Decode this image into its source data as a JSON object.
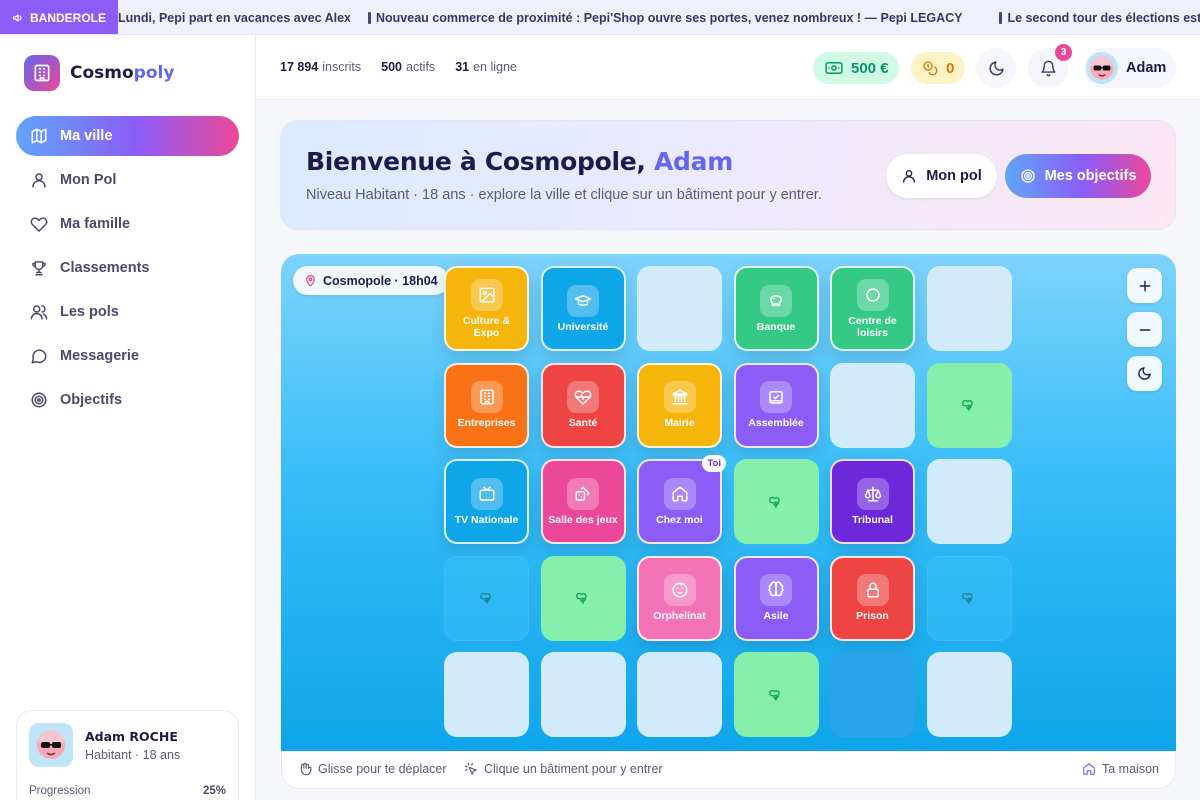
{
  "banner": {
    "tag": "BANDEROLE",
    "items": [
      "Lundi, Pepi part en vacances avec Alexis, Nathan et les Avalon ! — Krishna AVALON",
      "Nouveau commerce de proximité : Pepi'Shop ouvre ses portes, venez nombreux ! — Pepi LEGACY",
      "Le second tour des élections est en cours"
    ]
  },
  "brand": {
    "name_a": "Cosmo",
    "name_b": "poly"
  },
  "nav": [
    {
      "label": "Ma ville",
      "icon": "map-icon",
      "active": true
    },
    {
      "label": "Mon Pol",
      "icon": "user-icon"
    },
    {
      "label": "Ma famille",
      "icon": "heart-icon"
    },
    {
      "label": "Classements",
      "icon": "trophy-icon"
    },
    {
      "label": "Les pols",
      "icon": "users-icon"
    },
    {
      "label": "Messagerie",
      "icon": "message-icon"
    },
    {
      "label": "Objectifs",
      "icon": "target-icon"
    }
  ],
  "profile": {
    "name": "Adam ROCHE",
    "subtitle": "Habitant · 18 ans",
    "progress_label": "Progression",
    "progress_value": "25%",
    "progress": 0.25
  },
  "header": {
    "stats": [
      {
        "value": "17 894",
        "label": "inscrits"
      },
      {
        "value": "500",
        "label": "actifs"
      },
      {
        "value": "31",
        "label": "en ligne"
      }
    ],
    "money": "500 €",
    "coins": "0",
    "notifications": "3",
    "user": "Adam"
  },
  "welcome": {
    "title_prefix": "Bienvenue à Cosmopole, ",
    "title_name": "Adam",
    "subtitle": "Niveau Habitant · 18 ans · explore la ville et clique sur un bâtiment pour y entrer.",
    "btn_pol": "Mon pol",
    "btn_objectives": "Mes objectifs"
  },
  "map": {
    "location": "Cosmopole · 18h04",
    "you_badge": "Toi",
    "grid": [
      [
        {
          "type": "bld",
          "label": "Culture & Expo",
          "color": "#f5b50a",
          "icon": "image-icon"
        },
        {
          "type": "bld",
          "label": "Université",
          "color": "#0ea5e9",
          "icon": "graduation-cap-icon"
        },
        {
          "type": "empty"
        },
        {
          "type": "bld",
          "label": "Banque",
          "color": "#34c985",
          "icon": "piggy-bank-icon"
        },
        {
          "type": "bld",
          "label": "Centre de loisirs",
          "color": "#34c985",
          "icon": "circle-icon"
        },
        {
          "type": "empty"
        }
      ],
      [
        {
          "type": "bld",
          "label": "Entreprises",
          "color": "#f97316",
          "icon": "building-icon"
        },
        {
          "type": "bld",
          "label": "Santé",
          "color": "#ef4444",
          "icon": "heart-pulse-icon"
        },
        {
          "type": "bld",
          "label": "Mairie",
          "color": "#f5b50a",
          "icon": "landmark-icon"
        },
        {
          "type": "bld",
          "label": "Assemblée",
          "color": "#8b5cf6",
          "icon": "vote-icon"
        },
        {
          "type": "empty"
        },
        {
          "type": "park"
        }
      ],
      [
        {
          "type": "bld",
          "label": "TV Nationale",
          "color": "#0ea5e9",
          "icon": "tv-icon"
        },
        {
          "type": "bld",
          "label": "Salle des jeux",
          "color": "#ec4899",
          "icon": "dice-icon"
        },
        {
          "type": "bld",
          "label": "Chez moi",
          "color": "#8b5cf6",
          "icon": "house-icon",
          "you": true
        },
        {
          "type": "park"
        },
        {
          "type": "bld",
          "label": "Tribunal",
          "color": "#6d28d9",
          "icon": "scales-icon"
        },
        {
          "type": "empty"
        }
      ],
      [
        {
          "type": "dimpark"
        },
        {
          "type": "park"
        },
        {
          "type": "bld",
          "label": "Orphelinat",
          "color": "#f472b6",
          "icon": "baby-icon"
        },
        {
          "type": "bld",
          "label": "Asile",
          "color": "#8b5cf6",
          "icon": "brain-icon"
        },
        {
          "type": "bld",
          "label": "Prison",
          "color": "#ef4444",
          "icon": "lock-icon"
        },
        {
          "type": "dimpark"
        }
      ],
      [
        {
          "type": "empty"
        },
        {
          "type": "empty"
        },
        {
          "type": "empty"
        },
        {
          "type": "park"
        },
        {
          "type": "blue"
        },
        {
          "type": "empty"
        }
      ]
    ]
  },
  "footer": {
    "drag_hint": "Glisse pour te déplacer",
    "click_hint": "Clique un bâtiment pour y entrer",
    "home": "Ta maison"
  }
}
